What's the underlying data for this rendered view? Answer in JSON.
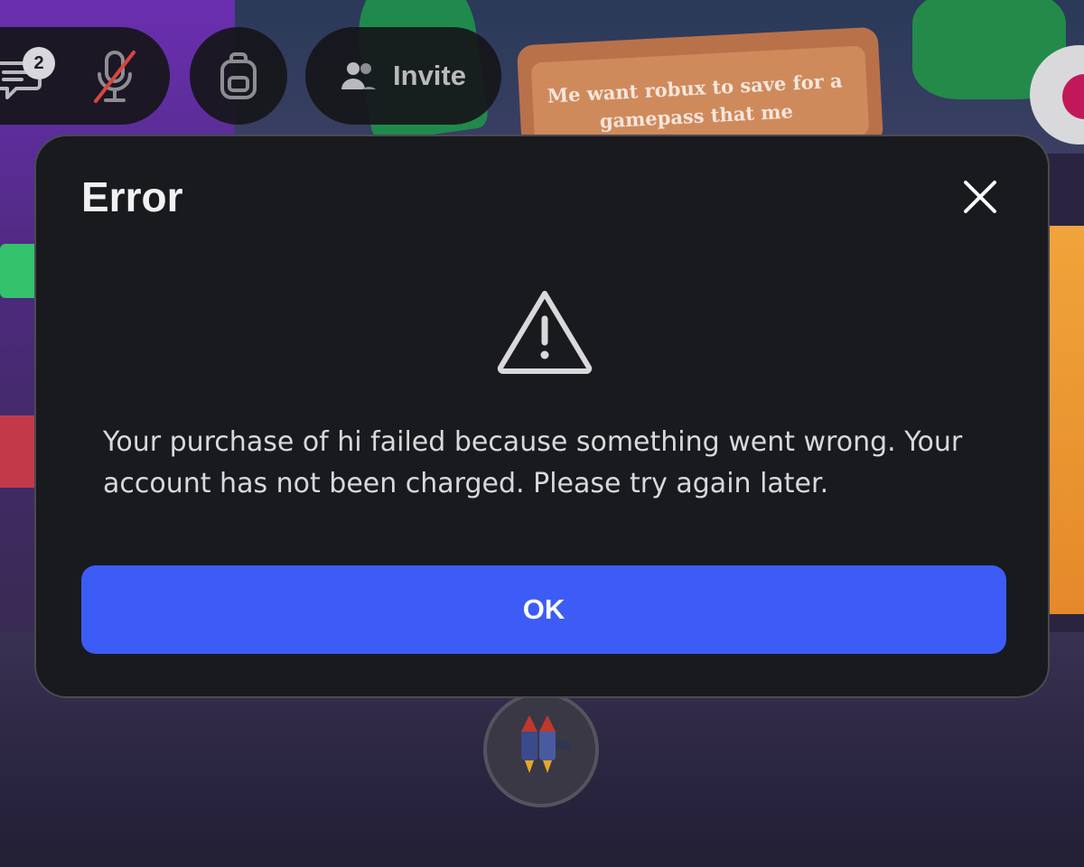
{
  "hud": {
    "chat_badge_count": "2",
    "chat_icon": "chat-icon",
    "mic_icon": "mic-muted-icon",
    "backpack_icon": "backpack-icon",
    "invite_icon": "people-icon",
    "invite_label": "Invite"
  },
  "scene": {
    "sign_text": "Me want robux to save for a gamepass that me"
  },
  "dialog": {
    "title": "Error",
    "close_icon": "close-icon",
    "warning_icon": "warning-icon",
    "message": "Your purchase of hi failed because something went wrong. Your account has not been charged. Please try again later.",
    "ok_label": "OK"
  },
  "colors": {
    "dialog_background": "#191a1e",
    "primary_button": "#3d5cf5",
    "text_primary": "#f1f1f3",
    "text_secondary": "#d9d9dc"
  }
}
